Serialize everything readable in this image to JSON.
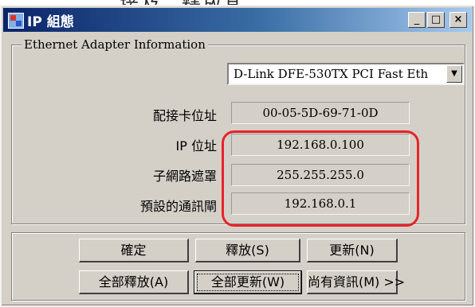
{
  "header_text": "接及、釋放其",
  "window": {
    "title": "IP 組態",
    "controls": {
      "minimize": "_",
      "maximize": "□",
      "close": "×"
    }
  },
  "adapter_group": {
    "legend": "Ethernet Adapter Information",
    "selected_adapter": "D-Link DFE-530TX PCI Fast Eth",
    "rows": [
      {
        "label": "配接卡位址",
        "value": "00-05-5D-69-71-0D"
      },
      {
        "label": "IP 位址",
        "value": "192.168.0.100"
      },
      {
        "label": "子網路遮罩",
        "value": "255.255.255.0"
      },
      {
        "label": "預設的通訊閘",
        "value": "192.168.0.1"
      }
    ]
  },
  "buttons": {
    "ok": "確定",
    "release": "釋放(S)",
    "renew": "更新(N)",
    "release_all": "全部釋放(A)",
    "renew_all": "全部更新(W)",
    "more_info": "尚有資訊(M) >>"
  },
  "colors": {
    "title_bar": "#0a246a",
    "face": "#d4d0c8",
    "highlight_ring": "#e8232a"
  }
}
